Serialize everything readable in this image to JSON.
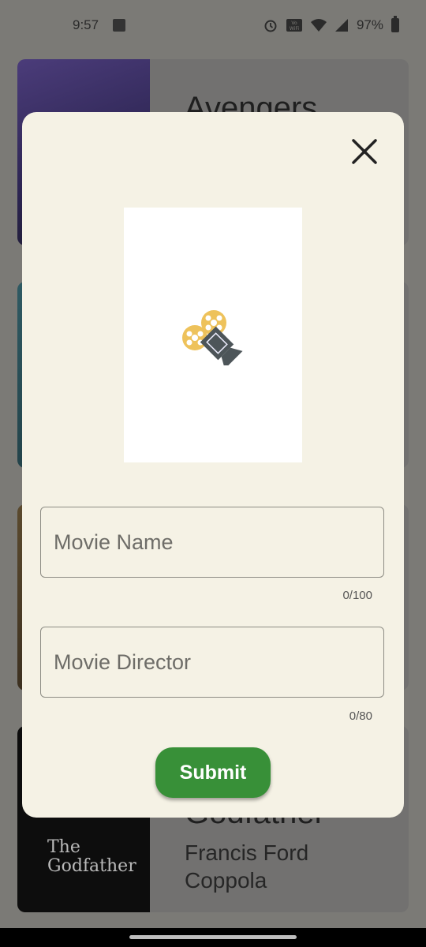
{
  "status": {
    "time": "9:57",
    "battery": "97%",
    "icons": [
      "gallery-icon",
      "alarm-icon",
      "vowifi-icon",
      "wifi-icon",
      "signal-icon",
      "battery-icon"
    ]
  },
  "list": {
    "cards": [
      {
        "title": "Avengers",
        "subtitle": ""
      },
      {
        "title": "",
        "subtitle": ""
      },
      {
        "title": "",
        "subtitle": ""
      },
      {
        "title": "Godfather",
        "subtitle_line1": "Francis Ford",
        "subtitle_line2": "Coppola"
      }
    ]
  },
  "dialog": {
    "close_icon": "close-icon",
    "image_icon": "movie-camera-icon",
    "movie_name": {
      "placeholder": "Movie Name",
      "counter": "0/100"
    },
    "movie_director": {
      "placeholder": "Movie Director",
      "counter": "0/80"
    },
    "submit_label": "Submit"
  },
  "colors": {
    "dialog_bg": "#f5f2e5",
    "submit": "#389038",
    "scrim": "#7b7a76"
  }
}
